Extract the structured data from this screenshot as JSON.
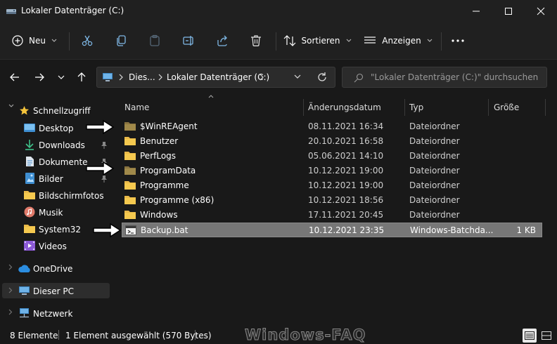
{
  "window": {
    "title": "Lokaler Datenträger (C:)",
    "controls": [
      "minimize",
      "maximize",
      "close"
    ]
  },
  "toolbar": {
    "new_label": "Neu",
    "sort_label": "Sortieren",
    "view_label": "Anzeigen",
    "icons": [
      "cut-icon",
      "copy-icon",
      "paste-icon",
      "rename-icon",
      "share-icon",
      "delete-icon",
      "more-icon"
    ]
  },
  "address": {
    "crumbs": [
      "Dies...",
      "Lokaler Datenträger (C:)"
    ],
    "search_placeholder": "\"Lokaler Datenträger (C:)\" durchsuchen"
  },
  "sidebar": {
    "quick_access": "Schnellzugriff",
    "items": [
      {
        "label": "Desktop",
        "icon": "desktop-icon",
        "pinned": true
      },
      {
        "label": "Downloads",
        "icon": "download-icon",
        "pinned": true
      },
      {
        "label": "Dokumente",
        "icon": "document-icon",
        "pinned": true
      },
      {
        "label": "Bilder",
        "icon": "pictures-icon",
        "pinned": true
      },
      {
        "label": "Bildschirmfotos",
        "icon": "folder-icon",
        "pinned": false
      },
      {
        "label": "Musik",
        "icon": "music-icon",
        "pinned": false
      },
      {
        "label": "System32",
        "icon": "folder-icon",
        "pinned": false
      },
      {
        "label": "Videos",
        "icon": "video-icon",
        "pinned": false
      }
    ],
    "onedrive": "OneDrive",
    "this_pc": "Dieser PC",
    "network": "Netzwerk"
  },
  "table": {
    "columns": [
      "Name",
      "Änderungsdatum",
      "Typ",
      "Größe"
    ],
    "rows": [
      {
        "name": "$WinREAgent",
        "date": "08.11.2021 16:34",
        "type": "Dateiordner",
        "size": "",
        "kind": "folder-hidden"
      },
      {
        "name": "Benutzer",
        "date": "20.10.2021 16:58",
        "type": "Dateiordner",
        "size": "",
        "kind": "folder"
      },
      {
        "name": "PerfLogs",
        "date": "05.06.2021 14:10",
        "type": "Dateiordner",
        "size": "",
        "kind": "folder"
      },
      {
        "name": "ProgramData",
        "date": "10.12.2021 19:00",
        "type": "Dateiordner",
        "size": "",
        "kind": "folder-hidden"
      },
      {
        "name": "Programme",
        "date": "10.12.2021 19:00",
        "type": "Dateiordner",
        "size": "",
        "kind": "folder"
      },
      {
        "name": "Programme (x86)",
        "date": "10.12.2021 18:56",
        "type": "Dateiordner",
        "size": "",
        "kind": "folder"
      },
      {
        "name": "Windows",
        "date": "17.11.2021 20:45",
        "type": "Dateiordner",
        "size": "",
        "kind": "folder"
      },
      {
        "name": "Backup.bat",
        "date": "10.12.2021 23:35",
        "type": "Windows-Batchda...",
        "size": "1 KB",
        "kind": "bat",
        "selected": true
      }
    ]
  },
  "status": {
    "count": "8 Elemente",
    "selection": "1 Element ausgewählt (570 Bytes)"
  },
  "watermark": "Windows-FAQ",
  "colors": {
    "background": "#191919",
    "chrome": "#202020",
    "folder": "#f2c14e",
    "folder_hidden": "#a0894a",
    "selection": "#777777",
    "accent": "#4aa3df"
  }
}
